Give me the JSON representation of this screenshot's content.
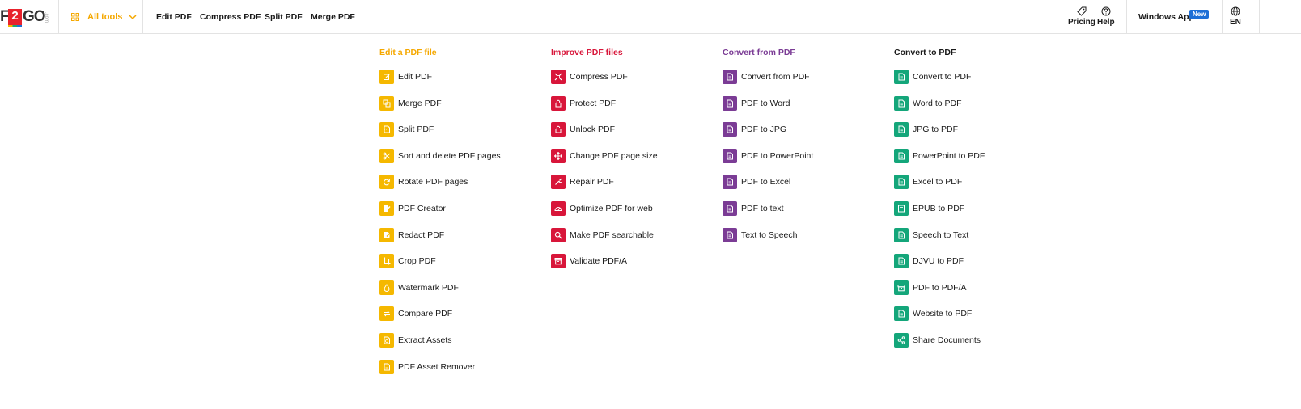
{
  "header": {
    "logo_text": {
      "f": "F",
      "two": "2",
      "go": "GO",
      "com": ".com"
    },
    "all_tools_label": "All tools",
    "nav": [
      "Edit PDF",
      "Compress PDF",
      "Split PDF",
      "Merge PDF"
    ],
    "pricing_label": "Pricing",
    "help_label": "Help",
    "windows_app_label": "Windows App",
    "new_badge": "New",
    "language": "EN"
  },
  "colors": {
    "yellow": "#f5b800",
    "red": "#d8163a",
    "purple": "#7b3c95",
    "green": "#14a67a",
    "accent": "#f5a800"
  },
  "menu": {
    "edit": {
      "title": "Edit a PDF file",
      "items": [
        "Edit PDF",
        "Merge PDF",
        "Split PDF",
        "Sort and delete PDF pages",
        "Rotate PDF pages",
        "PDF Creator",
        "Redact PDF",
        "Crop PDF",
        "Watermark PDF",
        "Compare PDF",
        "Extract Assets",
        "PDF Asset Remover"
      ],
      "icons": [
        "edit-icon",
        "merge-icon",
        "split-icon",
        "scissors-icon",
        "rotate-icon",
        "creator-icon",
        "redact-icon",
        "crop-icon",
        "watermark-icon",
        "compare-icon",
        "extract-icon",
        "remover-icon"
      ]
    },
    "improve": {
      "title": "Improve PDF files",
      "items": [
        "Compress PDF",
        "Protect PDF",
        "Unlock PDF",
        "Change PDF page size",
        "Repair PDF",
        "Optimize PDF for web",
        "Make PDF searchable",
        "Validate PDF/A"
      ],
      "icons": [
        "compress-icon",
        "lock-icon",
        "unlock-icon",
        "resize-icon",
        "repair-icon",
        "gauge-icon",
        "search-icon",
        "archive-icon"
      ]
    },
    "convert_from": {
      "title": "Convert from PDF",
      "items": [
        "Convert from PDF",
        "PDF to Word",
        "PDF to JPG",
        "PDF to PowerPoint",
        "PDF to Excel",
        "PDF to text",
        "Text to Speech"
      ],
      "icons": [
        "document-icon",
        "document-icon",
        "document-icon",
        "document-icon",
        "document-icon",
        "document-icon",
        "document-icon"
      ]
    },
    "convert_to": {
      "title": "Convert to PDF",
      "items": [
        "Convert to PDF",
        "Word to PDF",
        "JPG to PDF",
        "PowerPoint to PDF",
        "Excel to PDF",
        "EPUB to PDF",
        "Speech to Text",
        "DJVU to PDF",
        "PDF to PDF/A",
        "Website to PDF",
        "Share Documents"
      ],
      "icons": [
        "document-icon",
        "document-icon",
        "document-icon",
        "document-icon",
        "document-icon",
        "book-icon",
        "document-icon",
        "document-icon",
        "archive-icon",
        "document-icon",
        "share-icon"
      ]
    }
  }
}
